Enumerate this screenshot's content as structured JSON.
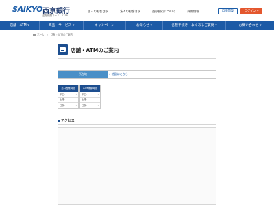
{
  "header": {
    "logo_latin": "SAIKYO",
    "logo_jp": "西京銀行",
    "logo_code": "金融機関コード：0158",
    "links": [
      "個人のお客さま",
      "法人のお客さま",
      "西京銀行について",
      "採用情報"
    ],
    "account_label": "口座開設",
    "login_label": "ログイン ▾"
  },
  "mainnav": {
    "items": [
      "店舗・ATM ▾",
      "商品・サービス ▾",
      "キャンペーン",
      "お知らせ ▾",
      "各種手続き・よくあるご質問 ▾",
      "お問い合わせ ▾"
    ]
  },
  "breadcrumb": {
    "home": "ホーム",
    "current": "店舗・ATMのご案内"
  },
  "page": {
    "title": "店舗・ATMのご案内"
  },
  "info": {
    "label": "所在地",
    "link": "» 地図はこちら"
  },
  "hours": [
    {
      "heading": "窓口営業時間",
      "rows": [
        {
          "day": "平日：",
          "time": "-"
        },
        {
          "day": "土曜：",
          "time": "-"
        },
        {
          "day": "日祝：",
          "time": "-"
        }
      ]
    },
    {
      "heading": "ATM稼働時間",
      "rows": [
        {
          "day": "平日：",
          "time": "-"
        },
        {
          "day": "土曜：",
          "time": "-"
        },
        {
          "day": "日祝：",
          "time": "-"
        }
      ]
    }
  ],
  "access": {
    "heading": "アクセス"
  },
  "colors": {
    "brand": "#1c5aa6",
    "login": "#e4572e",
    "table_head": "#4a8fc7"
  }
}
